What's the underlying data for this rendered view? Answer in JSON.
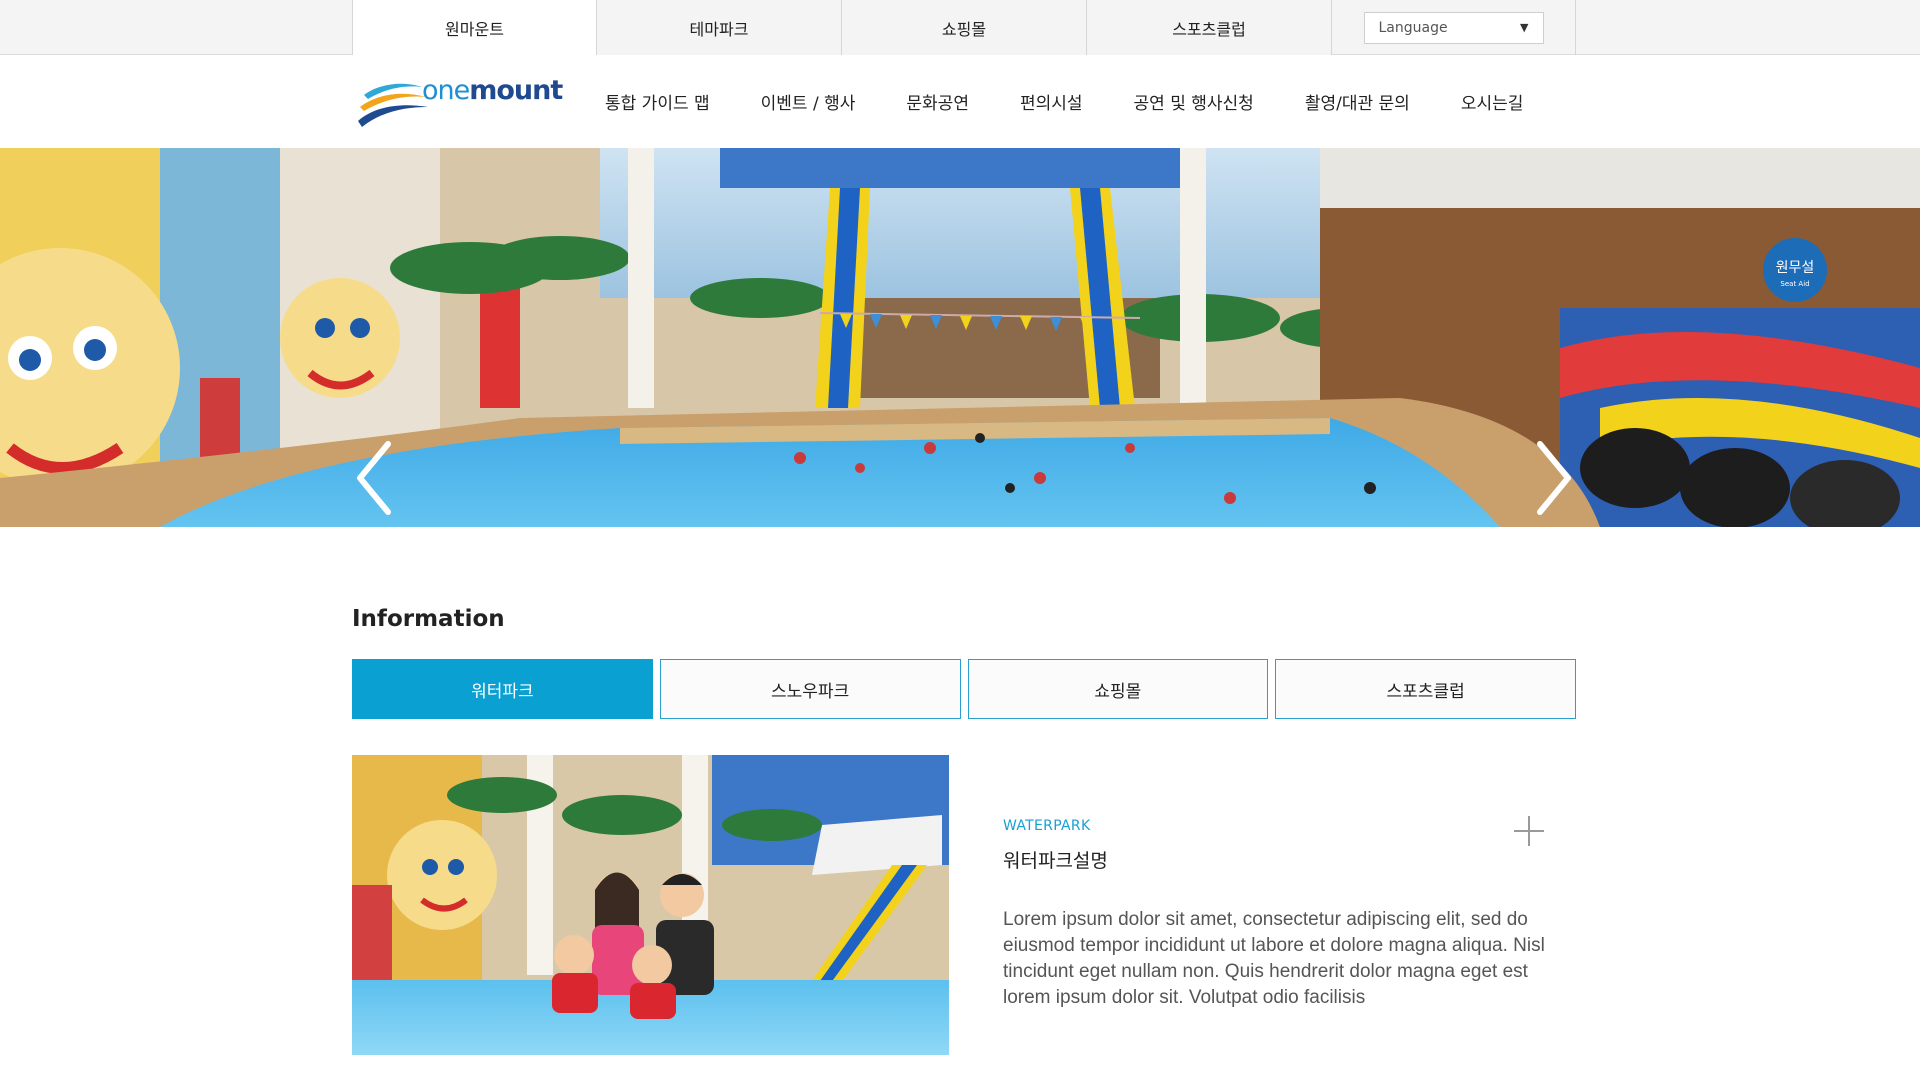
{
  "topbar": {
    "tabs": [
      "원마운트",
      "테마파크",
      "쇼핑몰",
      "스포츠클럽"
    ],
    "language_label": "Language"
  },
  "header": {
    "logo": {
      "part1": "one",
      "part2": "mount"
    },
    "nav": [
      "통합 가이드 맵",
      "이벤트 / 행사",
      "문화공연",
      "편의시설",
      "공연 및 행사신청",
      "촬영/대관 문의",
      "오시는길"
    ]
  },
  "hero": {
    "sign_text": "원무설",
    "sign_sub": "Seat Aid"
  },
  "information": {
    "title": "Information",
    "tabs": [
      "워터파크",
      "스노우파크",
      "쇼핑몰",
      "스포츠클럽"
    ],
    "active_tab": 0,
    "kicker": "WATERPARK",
    "heading": "워터파크설명",
    "body": "Lorem ipsum dolor sit amet, consectetur adipiscing elit, sed do eiusmod tempor incididunt ut labore et dolore magna aliqua. Nisl tincidunt eget nullam non. Quis hendrerit dolor magna eget est lorem ipsum dolor sit. Volutpat odio facilisis"
  },
  "colors": {
    "accent": "#0aa0d2",
    "logo_light": "#1f8fd1",
    "logo_dark": "#1f4a8f"
  }
}
